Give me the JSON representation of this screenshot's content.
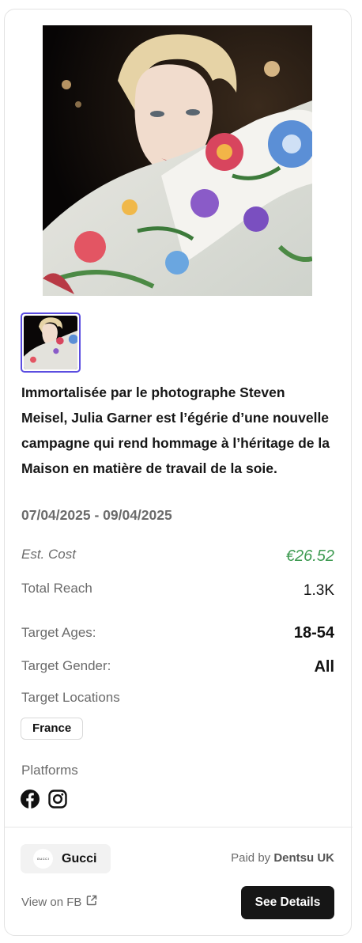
{
  "ad": {
    "description": "Immortalisée par le photographe Steven Meisel, Julia Garner est l’égérie d’une nouvelle campagne qui rend hommage à l’héritage de la Maison en matière de travail de la soie.",
    "dates": "07/04/2025 - 09/04/2025"
  },
  "stats": {
    "cost_label": "Est. Cost",
    "cost_value": "€26.52",
    "reach_label": "Total Reach",
    "reach_value": "1.3K",
    "ages_label": "Target Ages:",
    "ages_value": "18-54",
    "gender_label": "Target Gender:",
    "gender_value": "All",
    "locations_label": "Target Locations",
    "locations": [
      "France"
    ],
    "platforms_label": "Platforms",
    "platforms": [
      "facebook-icon",
      "instagram-icon"
    ]
  },
  "footer": {
    "brand_logo_text": "GUCCI",
    "brand_name": "Gucci",
    "paid_by_prefix": "Paid by ",
    "paid_by_name": "Dentsu UK",
    "view_link": "View on FB",
    "details_button": "See Details"
  },
  "colors": {
    "accent_border": "#5b4de0",
    "cost_green": "#3f9b52",
    "button_bg": "#161616"
  }
}
